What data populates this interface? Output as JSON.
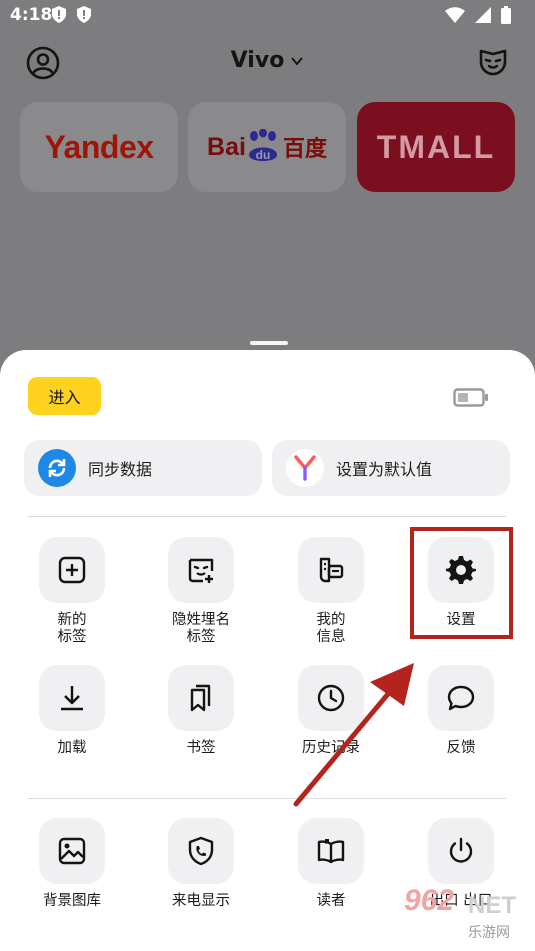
{
  "status_bar": {
    "time": "4:18"
  },
  "header": {
    "title": "Vivo"
  },
  "tiles": [
    {
      "name": "Yandex"
    },
    {
      "name": "Baidu",
      "text": "Bai",
      "du": "du",
      "cn": "百度"
    },
    {
      "name": "TMALL"
    }
  ],
  "sheet": {
    "enter_label": "进入",
    "sync_label": "同步数据",
    "default_label": "设置为默认值",
    "grid": [
      {
        "id": "new-tab",
        "label": "新的\n标签",
        "icon": "plus-square-icon"
      },
      {
        "id": "incognito",
        "label": "隐姓埋名\n标签",
        "icon": "incognito-tab-icon"
      },
      {
        "id": "my-info",
        "label": "我的\n信息",
        "icon": "id-card-icon"
      },
      {
        "id": "settings",
        "label": "设置",
        "icon": "gear-icon"
      },
      {
        "id": "downloads",
        "label": "加载",
        "icon": "download-icon"
      },
      {
        "id": "bookmarks",
        "label": "书签",
        "icon": "bookmarks-icon"
      },
      {
        "id": "history",
        "label": "历史记录",
        "icon": "clock-icon"
      },
      {
        "id": "feedback",
        "label": "反馈",
        "icon": "chat-bubble-icon"
      },
      {
        "id": "backgrounds",
        "label": "背景图库",
        "icon": "image-icon"
      },
      {
        "id": "caller-id",
        "label": "来电显示",
        "icon": "shield-phone-icon"
      },
      {
        "id": "reader",
        "label": "读者",
        "icon": "book-icon"
      },
      {
        "id": "exit",
        "label": "出口 出口",
        "icon": "power-icon"
      }
    ]
  },
  "watermark": {
    "num": "962",
    "net": "NET",
    "cn": "乐游网"
  },
  "colors": {
    "accent_yellow": "#ffd21e",
    "highlight_red": "#b3241d",
    "sync_blue": "#1e88e5"
  }
}
